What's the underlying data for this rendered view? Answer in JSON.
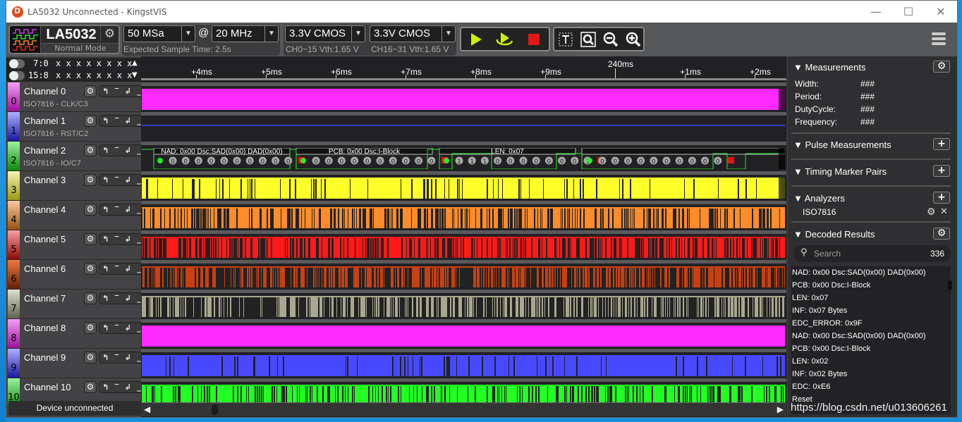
{
  "window": {
    "title": "LA5032 Unconnected - KingstVIS",
    "controls": [
      "minimize",
      "maximize",
      "close"
    ]
  },
  "toolbar": {
    "device_name": "LA5032",
    "device_mode": "Normal Mode",
    "sample_depth": "50 MSa",
    "at_symbol": "@",
    "sample_rate": "20 MHz",
    "expected_time": "Expected Sample Time: 2.5s",
    "threshold_1": "3.3V CMOS",
    "threshold_1_info": "CH0~15 Vth:1.65 V",
    "threshold_2": "3.3V CMOS",
    "threshold_2_info": "CH16~31 Vth:1.65 V",
    "icons": [
      "play-icon",
      "loop-play-icon",
      "stop-icon",
      "text-marker-icon",
      "zoom-fit-icon",
      "zoom-out-icon",
      "zoom-in-icon",
      "menu-icon"
    ]
  },
  "bit_groups": [
    {
      "label": "7:0",
      "bits": "x x x x x x x x"
    },
    {
      "label": "15:8",
      "bits": "x x x x x x x x"
    }
  ],
  "channels": [
    {
      "num": "0",
      "name": "Channel 0",
      "sub": "ISO7816 - CLK/C3",
      "color": "#ff2aff",
      "tab": [
        "#f4a0f4",
        "#9a109a"
      ]
    },
    {
      "num": "1",
      "name": "Channel 1",
      "sub": "ISO7816 - RST/C2",
      "color": "#4444ff",
      "tab": [
        "#b0b0ff",
        "#1818a0"
      ]
    },
    {
      "num": "2",
      "name": "Channel 2",
      "sub": "ISO7816 - IO/C7",
      "color": "#22ee22",
      "tab": [
        "#a0f0a0",
        "#0c8a0c"
      ]
    },
    {
      "num": "3",
      "name": "Channel 3",
      "sub": "",
      "color": "#ffff2a",
      "tab": [
        "#f4f4b0",
        "#9a9a10"
      ]
    },
    {
      "num": "4",
      "name": "Channel 4",
      "sub": "",
      "color": "#ff8c2a",
      "tab": [
        "#f8c8a0",
        "#9a5010"
      ]
    },
    {
      "num": "5",
      "name": "Channel 5",
      "sub": "",
      "color": "#ff1a1a",
      "tab": [
        "#f8a0a0",
        "#900808"
      ]
    },
    {
      "num": "6",
      "name": "Channel 6",
      "sub": "",
      "color": "#c84010",
      "tab": [
        "#f07840",
        "#602008"
      ]
    },
    {
      "num": "7",
      "name": "Channel 7",
      "sub": "",
      "color": "#a8a890",
      "tab": [
        "#e0e0d0",
        "#606050"
      ]
    },
    {
      "num": "8",
      "name": "Channel 8",
      "sub": "",
      "color": "#ff2aff",
      "tab": [
        "#f4a0f4",
        "#9a109a"
      ]
    },
    {
      "num": "9",
      "name": "Channel 9",
      "sub": "",
      "color": "#4848ff",
      "tab": [
        "#b0b0ff",
        "#1818a0"
      ]
    },
    {
      "num": "10",
      "name": "Channel 10",
      "sub": "",
      "color": "#22ff22",
      "tab": [
        "#a0f0a0",
        "#0c8a0c"
      ]
    }
  ],
  "trigger_icons": [
    "rising-edge",
    "high-level",
    "falling-edge",
    "low-level"
  ],
  "device_status": "Device unconnected",
  "ruler": {
    "ticks": [
      "+4ms",
      "+5ms",
      "+6ms",
      "+7ms",
      "+8ms",
      "+9ms",
      "240ms",
      "+1ms",
      "+2ms"
    ],
    "major": "240ms"
  },
  "decoded_annotations": [
    {
      "label": "NAD: 0x00 Dsc:SAD(0x00) DAD(0x00)",
      "bits": "0000000000"
    },
    {
      "label": "PCB: 0x00 Dsc:I-Block",
      "bits": "0000000000"
    },
    {
      "label": "LEN: 0x07",
      "bits": "11100000001"
    },
    {
      "label": "",
      "bits": "0000000000"
    }
  ],
  "right_panel": {
    "measurements": {
      "title": "Measurements",
      "rows": [
        {
          "label": "Width:",
          "value": "###"
        },
        {
          "label": "Period:",
          "value": "###"
        },
        {
          "label": "DutyCycle:",
          "value": "###"
        },
        {
          "label": "Frequency:",
          "value": "###"
        }
      ]
    },
    "pulse_measurements": "Pulse Measurements",
    "timing_marker_pairs": "Timing Marker Pairs",
    "analyzers": {
      "title": "Analyzers",
      "items": [
        "ISO7816"
      ]
    },
    "decoded_results": {
      "title": "Decoded Results",
      "search_placeholder": "Search",
      "count": "336",
      "items": [
        "NAD: 0x00 Dsc:SAD(0x00) DAD(0x00)",
        "PCB: 0x00 Dsc:I-Block",
        "LEN: 0x07",
        "INF: 0x07 Bytes",
        "EDC_ERROR: 0x9F",
        "NAD: 0x00 Dsc:SAD(0x00) DAD(0x00)",
        "PCB: 0x00 Dsc:I-Block",
        "LEN: 0x02",
        "INF: 0x02 Bytes",
        "EDC: 0xE6",
        "Reset"
      ]
    }
  },
  "watermark": "https://blog.csdn.net/u013606261"
}
